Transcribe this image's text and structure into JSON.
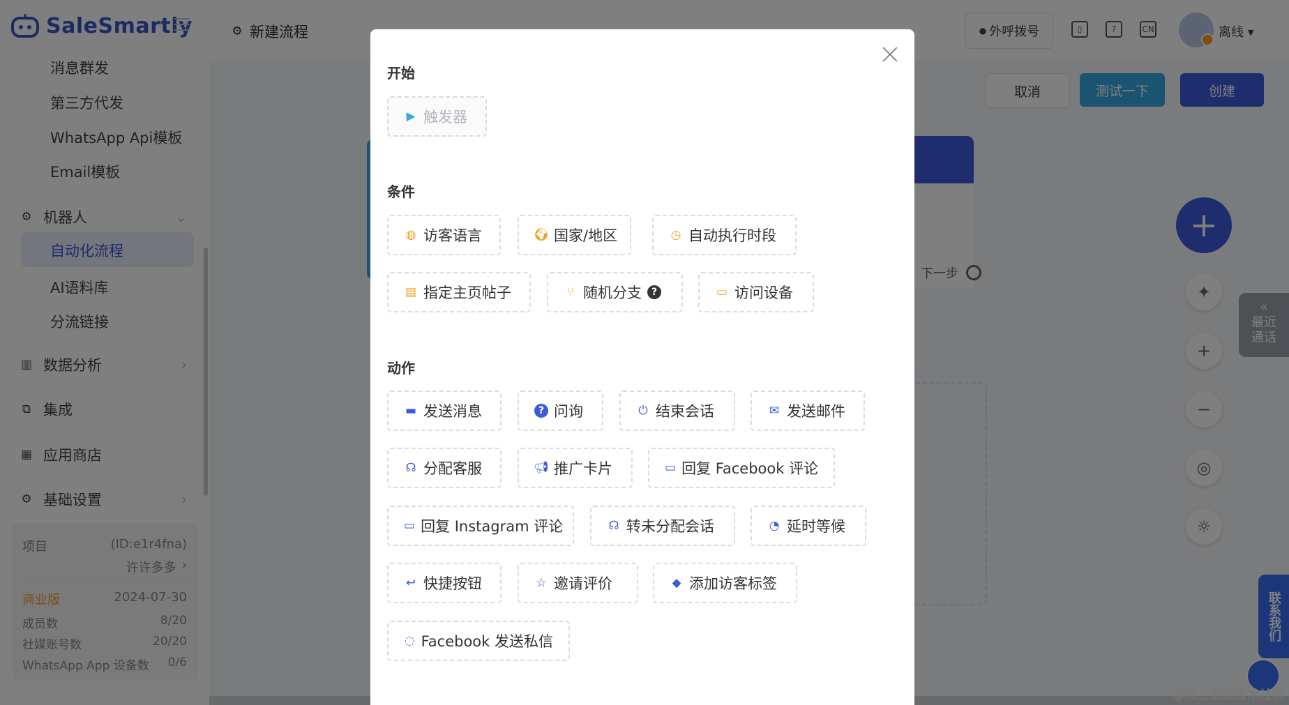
{
  "app": {
    "logo_text": "SaleSmartly",
    "page_title": "新建流程"
  },
  "sidebar": {
    "sub_top": [
      "消息群发",
      "第三方代发",
      "WhatsApp Api模板",
      "Email模板"
    ],
    "group_robot": "机器人",
    "active_item": "自动化流程",
    "sub_robot": [
      "AI语料库",
      "分流链接"
    ],
    "groups": [
      "数据分析",
      "集成",
      "应用商店",
      "基础设置"
    ]
  },
  "project": {
    "label": "项目",
    "id": "(ID:e1r4fna)",
    "owner": "许许多多",
    "plan": "商业版",
    "expire": "2024-07-30",
    "stats": [
      {
        "label": "成员数",
        "value": "8/20"
      },
      {
        "label": "社媒账号数",
        "value": "20/20"
      },
      {
        "label": "WhatsApp App 设备数",
        "value": "0/6"
      }
    ]
  },
  "topbar": {
    "dial": "外呼拨号",
    "lang": "CN",
    "status": "离线"
  },
  "actions": {
    "cancel": "取消",
    "test": "测试一下",
    "create": "创建"
  },
  "canvas": {
    "next_step": "下一步"
  },
  "side_panel": {
    "recent_calls": "最近通话",
    "contact_us": "联系我们"
  },
  "watermark": "@稀土掘金技术社区",
  "modal": {
    "start_title": "开始",
    "trigger": "触发器",
    "condition_title": "条件",
    "conditions": [
      "访客语言",
      "国家/地区",
      "自动执行时段",
      "指定主页帖子",
      "随机分支",
      "访问设备"
    ],
    "action_title": "动作",
    "actions": [
      "发送消息",
      "问询",
      "结束会话",
      "发送邮件",
      "分配客服",
      "推广卡片",
      "回复 Facebook 评论",
      "回复 Instagram 评论",
      "转未分配会话",
      "延时等候",
      "快捷按钮",
      "邀请评价",
      "添加访客标签",
      "Facebook 发送私信"
    ]
  },
  "colors": {
    "primary": "#3b5bdb",
    "test_btn": "#36a9e1",
    "accent_orange": "#f0a020"
  }
}
